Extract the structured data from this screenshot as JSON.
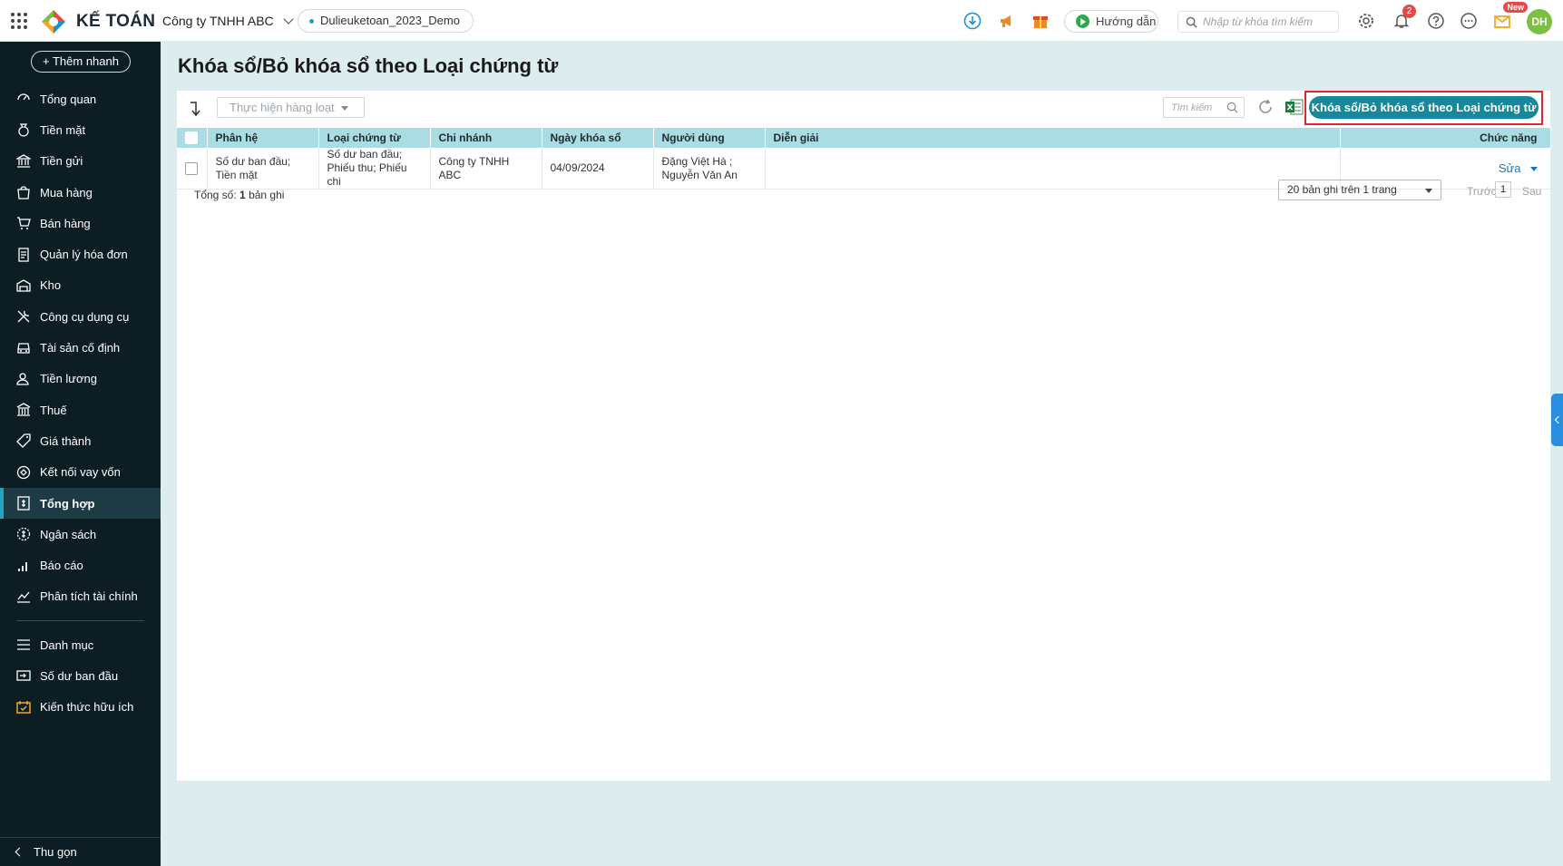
{
  "app": {
    "logo_text": "KẾ TOÁN",
    "company": "Công ty TNHH ABC",
    "dataset": "Dulieuketoan_2023_Demo",
    "guide_label": "Hướng dẫn",
    "search_placeholder": "Nhập từ khóa tìm kiếm",
    "notification_count": "2",
    "new_badge": "New",
    "avatar_initials": "DH"
  },
  "sidebar": {
    "quick_add": "+ Thêm nhanh",
    "items": [
      {
        "label": "Tổng quan",
        "icon": "dashboard-icon"
      },
      {
        "label": "Tiền mặt",
        "icon": "cash-bag-icon"
      },
      {
        "label": "Tiền gửi",
        "icon": "bank-icon"
      },
      {
        "label": "Mua hàng",
        "icon": "shopping-bag-icon"
      },
      {
        "label": "Bán hàng",
        "icon": "cart-icon"
      },
      {
        "label": "Quản lý hóa đơn",
        "icon": "invoice-icon"
      },
      {
        "label": "Kho",
        "icon": "warehouse-icon"
      },
      {
        "label": "Công cụ dụng cụ",
        "icon": "tools-icon"
      },
      {
        "label": "Tài sản cố định",
        "icon": "car-icon"
      },
      {
        "label": "Tiền lương",
        "icon": "payroll-icon"
      },
      {
        "label": "Thuế",
        "icon": "tax-building-icon"
      },
      {
        "label": "Giá thành",
        "icon": "price-tag-icon"
      },
      {
        "label": "Kết nối vay vốn",
        "icon": "loan-icon"
      },
      {
        "label": "Tổng hợp",
        "icon": "ledger-icon"
      },
      {
        "label": "Ngân sách",
        "icon": "budget-icon"
      },
      {
        "label": "Báo cáo",
        "icon": "report-bars-icon"
      },
      {
        "label": "Phân tích tài chính",
        "icon": "analytics-icon"
      }
    ],
    "items2": [
      {
        "label": "Danh mục",
        "icon": "list-icon"
      },
      {
        "label": "Số dư ban đầu",
        "icon": "opening-balance-icon"
      },
      {
        "label": "Kiến thức hữu ích",
        "icon": "knowledge-icon"
      }
    ],
    "collapse_label": "Thu gọn",
    "accent_color": "#24a4c0"
  },
  "page": {
    "title": "Khóa sổ/Bỏ khóa sổ theo Loại chứng từ",
    "bulk_action": "Thực hiện hàng loạt",
    "search_placeholder": "Tìm kiếm",
    "primary_button": "Khóa sổ/Bỏ khóa sổ theo Loại chứng từ",
    "primary_color": "#15899b"
  },
  "table": {
    "columns": [
      "Phân hệ",
      "Loại chứng từ",
      "Chi nhánh",
      "Ngày khóa sổ",
      "Người dùng",
      "Diễn giải",
      "Chức năng"
    ],
    "rows": [
      {
        "phan_he": "Số dư ban đầu; Tiền mặt",
        "loai_chung_tu": "Số dư ban đầu; Phiếu thu; Phiếu chi",
        "chi_nhanh": "Công ty TNHH ABC",
        "ngay_khoa_so": "04/09/2024",
        "nguoi_dung": "Đặng Việt Hà ; Nguyễn Văn An",
        "dien_giai": "",
        "action": "Sửa"
      }
    ]
  },
  "footer": {
    "total_label": "Tổng số:",
    "total_count": "1",
    "total_suffix": "bản ghi",
    "page_size": "20 bản ghi trên 1 trang",
    "prev": "Trước",
    "page": "1",
    "next": "Sau"
  }
}
